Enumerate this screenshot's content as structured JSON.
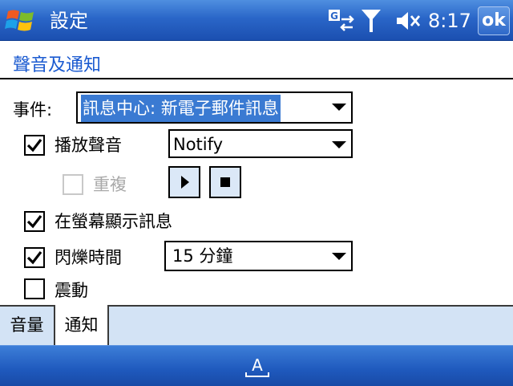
{
  "titlebar": {
    "title": "設定",
    "time": "8:17",
    "ok_label": "ok",
    "icons": [
      "windows-start-icon",
      "connectivity-icon",
      "signal-strength-icon",
      "volume-mute-icon"
    ]
  },
  "section": {
    "title": "聲音及通知"
  },
  "form": {
    "event_label": "事件:",
    "event_value": "訊息中心: 新電子郵件訊息",
    "play_sound": {
      "label": "播放聲音",
      "checked": true
    },
    "sound_value": "Notify",
    "repeat": {
      "label": "重複",
      "checked": false,
      "disabled": true
    },
    "display_message": {
      "label": "在螢幕顯示訊息",
      "checked": true
    },
    "flash": {
      "label": "閃爍時間",
      "checked": true
    },
    "flash_value": "15 分鐘",
    "vibrate": {
      "label": "震動",
      "checked": false
    }
  },
  "tabs": [
    {
      "label": "音量",
      "active": false
    },
    {
      "label": "通知",
      "active": true
    }
  ],
  "bottombar": {
    "icon": "keyboard-input-icon",
    "icon_letter": "A"
  },
  "colors": {
    "title_bar": "#2a66c8",
    "section_title": "#1a5ad0",
    "selection": "#3a7ad2",
    "tab_strip": "#d3e3f5"
  }
}
